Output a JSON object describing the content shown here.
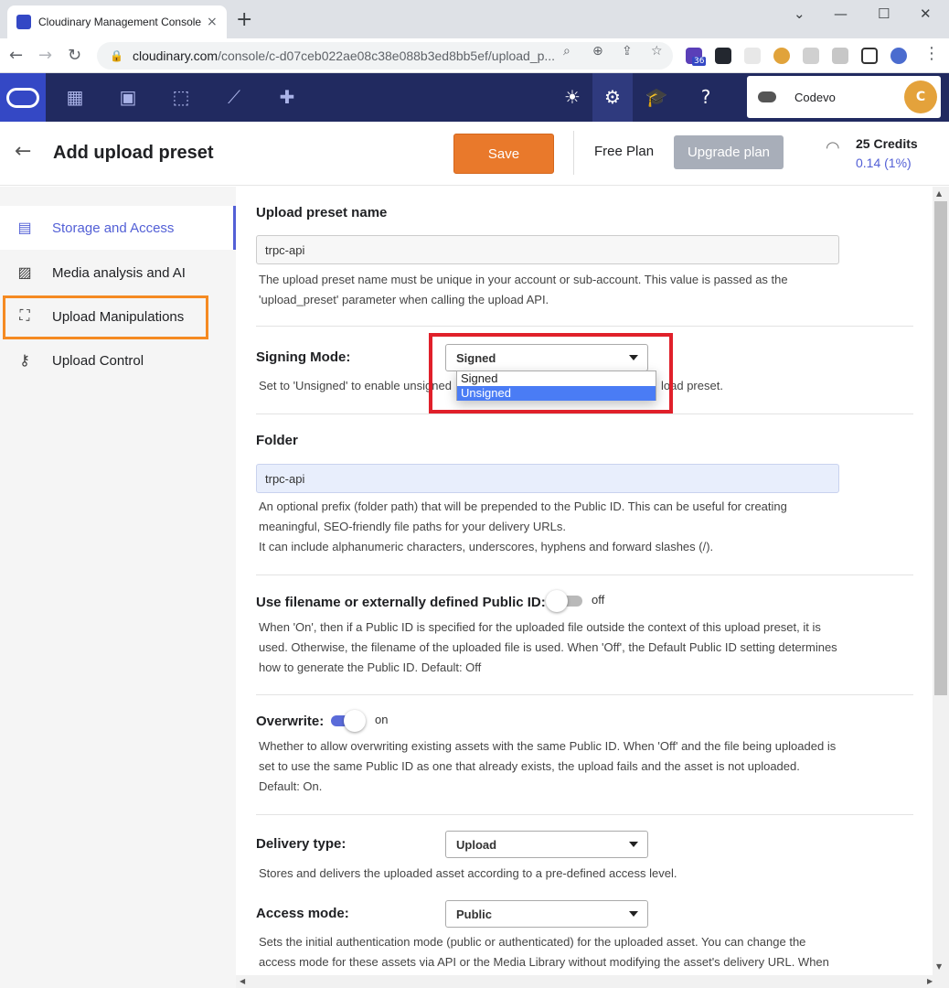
{
  "browser": {
    "tab_title": "Cloudinary Management Console",
    "tab_close": "×",
    "new_tab": "+",
    "url_host": "cloudinary.com",
    "url_path": "/console/c-d07ceb022ae08c38e088b3ed8bb5ef/upload_p...",
    "extension_badge": "36",
    "window_controls": [
      "⌄",
      "—",
      "☐",
      "✕"
    ]
  },
  "app": {
    "account_name": "Codevo",
    "avatar_initial": "C"
  },
  "page": {
    "title": "Add upload preset",
    "save_label": "Save",
    "plan": "Free Plan",
    "upgrade_label": "Upgrade plan",
    "credits": "25 Credits",
    "credits_usage": "0.14 (1%)"
  },
  "sidebar": {
    "items": [
      {
        "label": "Storage and Access",
        "icon": "storage-icon",
        "active": true
      },
      {
        "label": "Media analysis and AI",
        "icon": "image-analysis-icon"
      },
      {
        "label": "Upload Manipulations",
        "icon": "crop-frame-icon"
      },
      {
        "label": "Upload Control",
        "icon": "key-icon"
      }
    ]
  },
  "form": {
    "preset_name_label": "Upload preset name",
    "preset_name_value": "trpc-api",
    "preset_name_help_1": "The upload preset name must be unique in your account or sub-account. This value is passed as the",
    "preset_name_help_2": "'upload_preset' parameter when calling the upload API.",
    "signing_mode_label": "Signing Mode:",
    "signing_mode_value": "Signed",
    "signing_mode_help_left": "Set to 'Unsigned' to enable unsigned",
    "signing_mode_help_right": "load preset.",
    "signing_mode_options": [
      "Signed",
      "Unsigned"
    ],
    "folder_label": "Folder",
    "folder_value": "trpc-api",
    "folder_help_1": "An optional prefix (folder path) that will be prepended to the Public ID. This can be useful for creating",
    "folder_help_2": "meaningful, SEO-friendly file paths for your delivery URLs.",
    "folder_help_3": "It can include alphanumeric characters, underscores, hyphens and forward slashes (/).",
    "filename_label": "Use filename or externally defined Public ID:",
    "filename_state": "off",
    "filename_help_1": "When 'On', then if a Public ID is specified for the uploaded file outside the context of this upload preset, it is",
    "filename_help_2": "used. Otherwise, the filename of the uploaded file is used. When 'Off', the Default Public ID setting determines",
    "filename_help_3": "how to generate the Public ID. Default: Off",
    "overwrite_label": "Overwrite:",
    "overwrite_state": "on",
    "overwrite_help_1": "Whether to allow overwriting existing assets with the same Public ID. When 'Off' and the file being uploaded is",
    "overwrite_help_2": "set to use the same Public ID as one that already exists, the upload fails and the asset is not uploaded.",
    "overwrite_help_3": "Default: On.",
    "delivery_label": "Delivery type:",
    "delivery_value": "Upload",
    "delivery_help": "Stores and delivers the uploaded asset according to a pre-defined access level.",
    "access_label": "Access mode:",
    "access_value": "Public",
    "access_help_1": "Sets the initial authentication mode (public or authenticated) for the uploaded asset. You can change the",
    "access_help_2": "access mode for these assets via API or the Media Library without modifying the asset's delivery URL. When"
  },
  "colors": {
    "app_bar": "#212a60",
    "accent": "#5360d6",
    "save": "#e9792b",
    "highlight_orange": "#f58a22",
    "highlight_red": "#e0202a"
  }
}
